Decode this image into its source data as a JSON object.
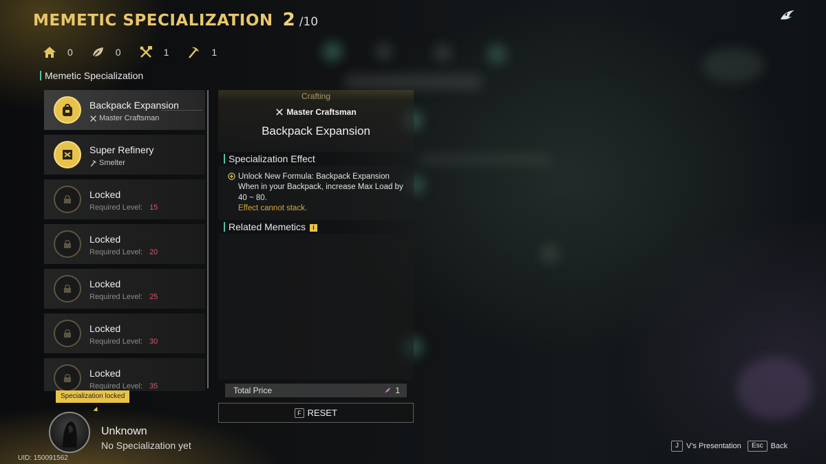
{
  "header": {
    "title": "MEMETIC SPECIALIZATION",
    "points_current": "2",
    "points_max": "/10"
  },
  "counters": [
    {
      "icon": "home-icon",
      "value": "0"
    },
    {
      "icon": "leaf-icon",
      "value": "0"
    },
    {
      "icon": "crossed-tools-icon",
      "value": "1"
    },
    {
      "icon": "pickaxe-icon",
      "value": "1"
    }
  ],
  "list_section_label": "Memetic Specialization",
  "specializations": [
    {
      "name": "Backpack Expansion",
      "sub": "Master Craftsman",
      "status": "unlocked",
      "selected": true
    },
    {
      "name": "Super Refinery",
      "sub": "Smelter",
      "status": "unlocked",
      "selected": false
    },
    {
      "name": "Locked",
      "req_label": "Required Level:",
      "req_value": "15",
      "status": "locked"
    },
    {
      "name": "Locked",
      "req_label": "Required Level:",
      "req_value": "20",
      "status": "locked"
    },
    {
      "name": "Locked",
      "req_label": "Required Level:",
      "req_value": "25",
      "status": "locked"
    },
    {
      "name": "Locked",
      "req_label": "Required Level:",
      "req_value": "30",
      "status": "locked"
    },
    {
      "name": "Locked",
      "req_label": "Required Level:",
      "req_value": "35",
      "status": "locked"
    }
  ],
  "detail": {
    "category": "Crafting",
    "profession": "Master Craftsman",
    "title": "Backpack Expansion",
    "effect_label": "Specialization Effect",
    "effect_lines": [
      "Unlock New Formula: Backpack Expansion",
      "When in your Backpack, increase Max Load by",
      "40 ~ 80."
    ],
    "effect_warning": "Effect cannot stack.",
    "related_label": "Related Memetics",
    "total_price_label": "Total Price",
    "total_price_value": "1",
    "reset_key": "F",
    "reset_label": "RESET"
  },
  "profile": {
    "tooltip": "Specialization locked",
    "name": "Unknown",
    "status": "No Specialization yet",
    "uid": "UID: 150091562"
  },
  "hints": [
    {
      "key": "J",
      "label": "V's Presentation"
    },
    {
      "key": "Esc",
      "label": "Back"
    }
  ],
  "colors": {
    "accent_gold": "#e8c66a",
    "accent_teal": "#4fc3b0",
    "required_level": "#d9556b",
    "warning": "#d8a83c"
  }
}
